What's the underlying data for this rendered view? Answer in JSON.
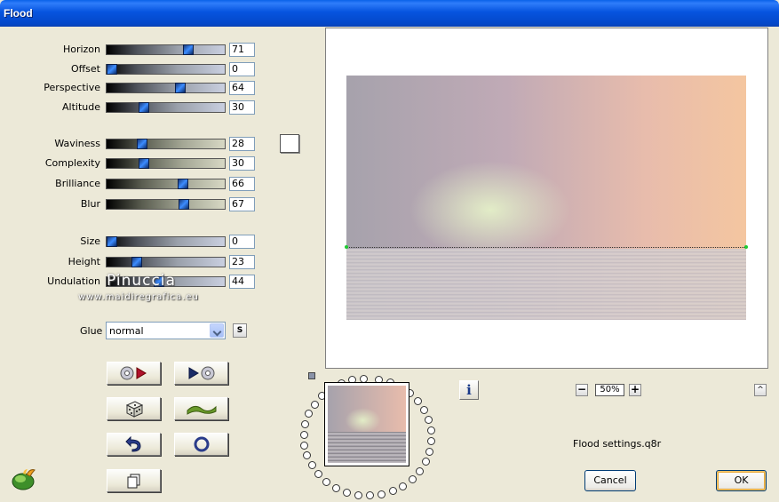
{
  "window": {
    "title": "Flood"
  },
  "group1": [
    {
      "label": "Horizon",
      "value": "71",
      "fraction": 0.71
    },
    {
      "label": "Offset",
      "value": "0",
      "fraction": 0.0
    },
    {
      "label": "Perspective",
      "value": "64",
      "fraction": 0.64
    },
    {
      "label": "Altitude",
      "value": "30",
      "fraction": 0.3
    }
  ],
  "group2": [
    {
      "label": "Waviness",
      "value": "28",
      "fraction": 0.28
    },
    {
      "label": "Complexity",
      "value": "30",
      "fraction": 0.3
    },
    {
      "label": "Brilliance",
      "value": "66",
      "fraction": 0.66
    },
    {
      "label": "Blur",
      "value": "67",
      "fraction": 0.67
    }
  ],
  "group3": [
    {
      "label": "Size",
      "value": "0",
      "fraction": 0.0
    },
    {
      "label": "Height",
      "value": "23",
      "fraction": 0.23
    },
    {
      "label": "Undulation",
      "value": "44",
      "fraction": 0.44
    }
  ],
  "watermark": {
    "line1": "Pinuccia",
    "line2": "www.maidiregrafica.eu"
  },
  "glue": {
    "label": "Glue",
    "value": "normal"
  },
  "s_button": "S",
  "info_button": "i",
  "zoom": {
    "value": "50%",
    "minus": "−",
    "plus": "+"
  },
  "caret_button": "^",
  "settings_file": "Flood settings.q8r",
  "buttons": {
    "cancel": "Cancel",
    "ok": "OK"
  },
  "colors": {
    "title_bar": "#0654df",
    "window_bg": "#ece9d8",
    "horizon_marker": "#1ecb33"
  }
}
